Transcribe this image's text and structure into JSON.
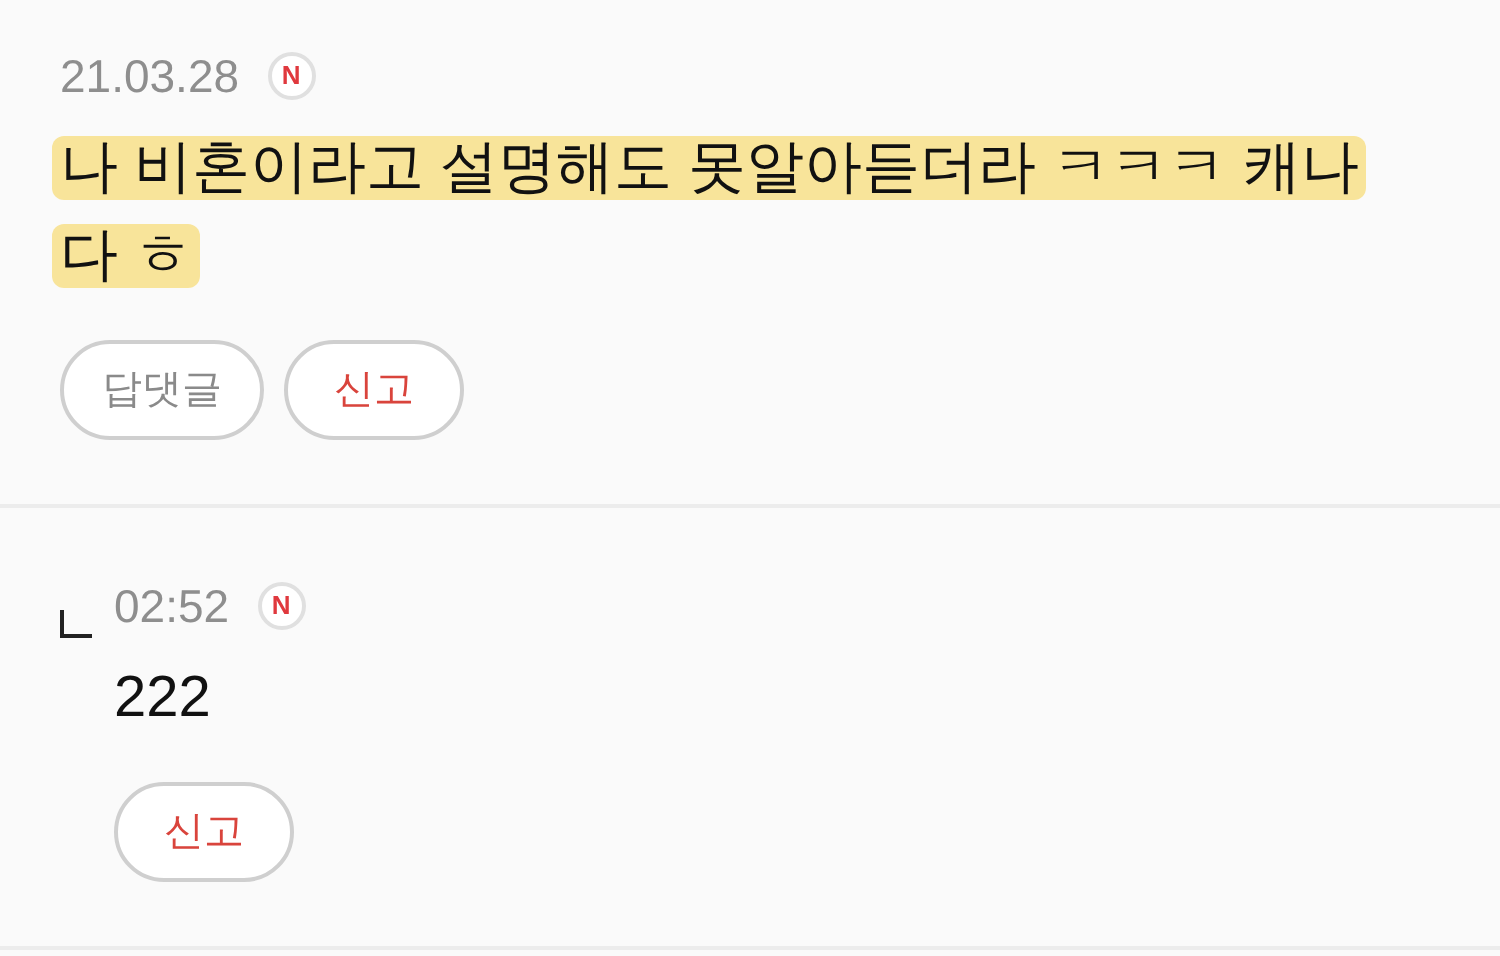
{
  "comments": [
    {
      "is_reply": false,
      "date": "21.03.28",
      "badge": "N",
      "text": "나 비혼이라고 설명해도 못알아듣더라 ㅋㅋㅋ 캐나다 ㅎ",
      "highlighted": true,
      "buttons": [
        {
          "kind": "reply",
          "label": "답댓글"
        },
        {
          "kind": "report",
          "label": "신고"
        }
      ]
    },
    {
      "is_reply": true,
      "date": "02:52",
      "badge": "N",
      "text": "222",
      "highlighted": false,
      "buttons": [
        {
          "kind": "report",
          "label": "신고"
        }
      ]
    }
  ]
}
